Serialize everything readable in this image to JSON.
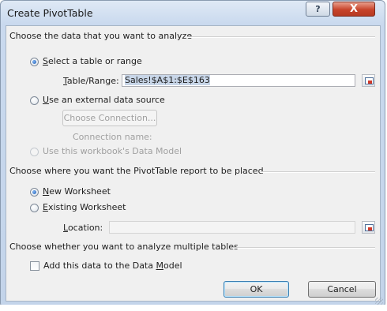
{
  "window": {
    "title": "Create PivotTable",
    "help_glyph": "?",
    "close_glyph": "X"
  },
  "section_data": {
    "heading": "Choose the data that you want to analyze",
    "option_table": {
      "pre": "",
      "accel": "S",
      "post": "elect a table or range",
      "selected": true
    },
    "table_range": {
      "accel": "T",
      "post": "able/Range:",
      "value": "Sales!$A$1:$E$163"
    },
    "option_external": {
      "pre": "",
      "accel": "U",
      "post": "se an external data source",
      "selected": false
    },
    "choose_connection_label": "Choose Connection...",
    "connection_name_label": "Connection name:",
    "option_model": {
      "label": "Use this workbook's Data Model",
      "selected": false,
      "enabled": false
    }
  },
  "section_placement": {
    "heading": "Choose where you want the PivotTable report to be placed",
    "option_new": {
      "pre": "",
      "accel": "N",
      "post": "ew Worksheet",
      "selected": true
    },
    "option_existing": {
      "pre": "",
      "accel": "E",
      "post": "xisting Worksheet",
      "selected": false
    },
    "location": {
      "accel": "L",
      "post": "ocation:",
      "value": ""
    }
  },
  "section_multiple": {
    "heading": "Choose whether you want to analyze multiple tables",
    "checkbox": {
      "pre": "Add this data to the Data ",
      "accel": "M",
      "post": "odel",
      "checked": false
    }
  },
  "buttons": {
    "ok": "OK",
    "cancel": "Cancel"
  }
}
